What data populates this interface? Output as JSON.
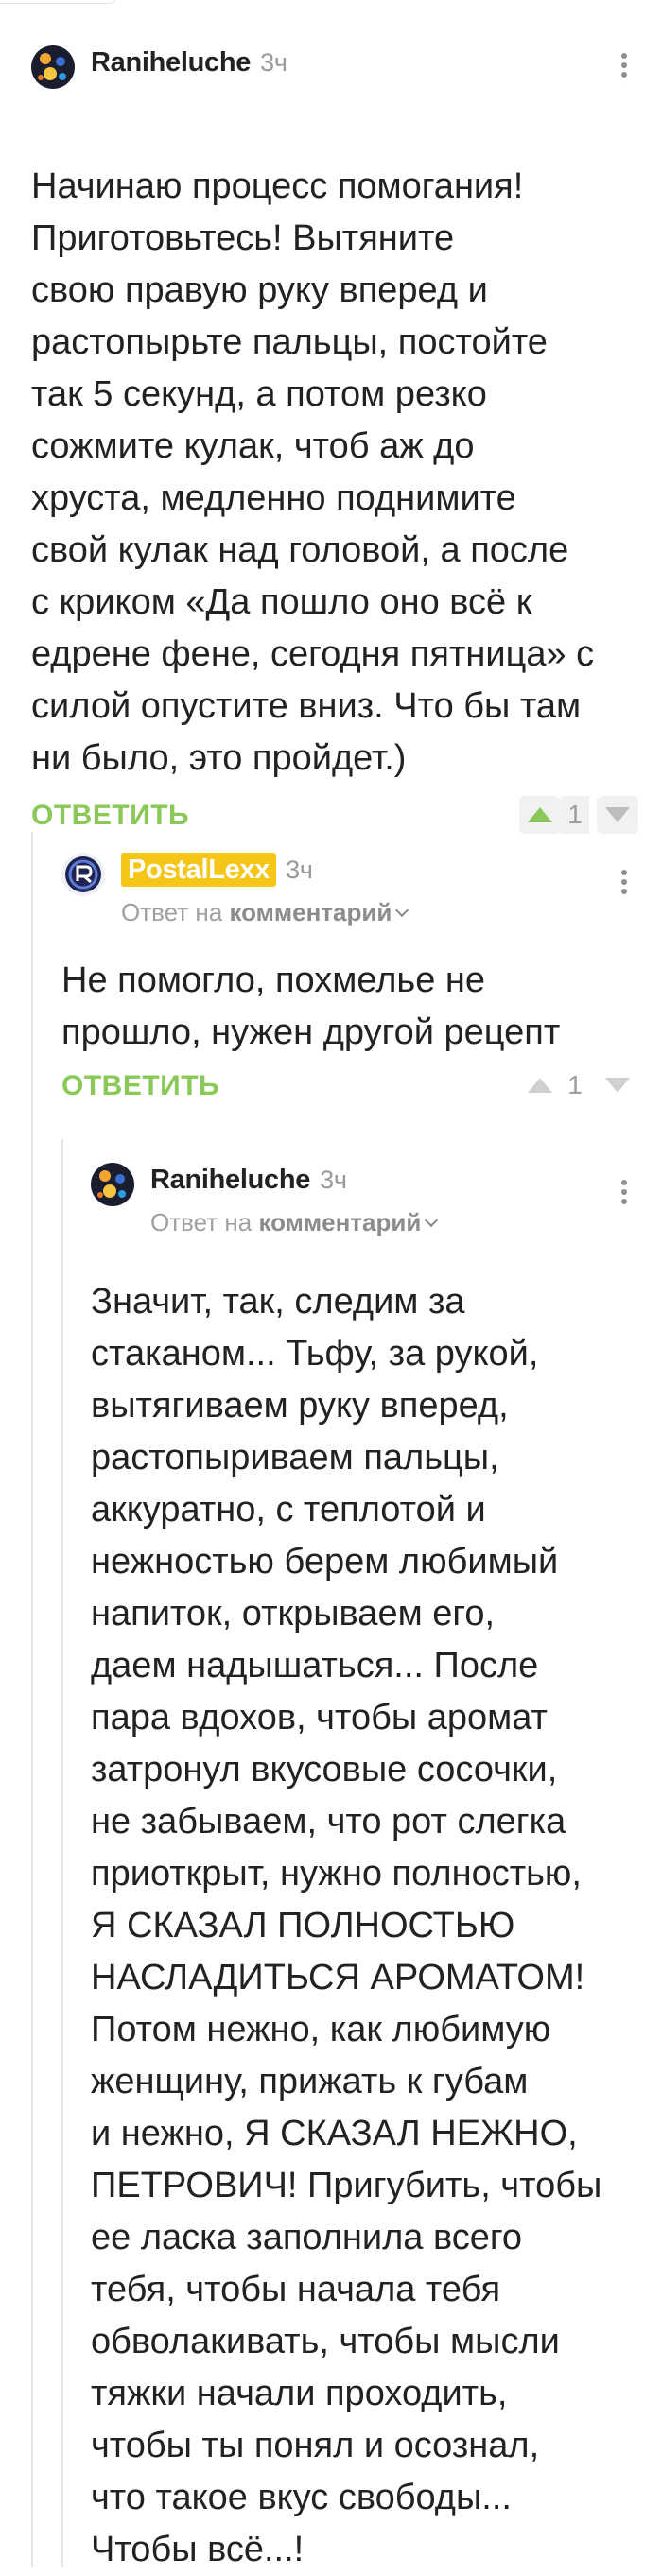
{
  "comments": [
    {
      "author": "Raniheluche",
      "time": "3ч",
      "text": "Начинаю процесс помогания!\nПриготовьтесь! Вытяните\nсвою правую руку вперед и\nрастопырьте пальцы, постойте\nтак 5 секунд, а потом резко\nсожмите кулак, чтоб аж до\nхруста, медленно поднимите\nсвой кулак над головой, а после\nс криком «Да пошло оно всё к\nедрене фене, сегодня пятница» с\nсилой опустите вниз. Что бы там\nни было, это пройдет.)",
      "reply_label": "ОТВЕТИТЬ",
      "votes": "1",
      "voted_up": true
    },
    {
      "author": "PostalLexx",
      "time": "3ч",
      "reply_prefix": "Ответ на",
      "reply_target": "комментарий",
      "text": "Не помогло, похмелье не\nпрошло, нужен другой рецепт",
      "reply_label": "ОТВЕТИТЬ",
      "votes": "1",
      "voted_up": false
    },
    {
      "author": "Raniheluche",
      "time": "3ч",
      "reply_prefix": "Ответ на",
      "reply_target": "комментарий",
      "text": "Значит, так, следим за\nстаканом... Тьфу, за рукой,\nвытягиваем руку вперед,\nрастопыриваем пальцы,\nаккуратно, с теплотой и\nнежностью берем любимый\nнапиток, открываем его,\nдаем надышаться... После\nпара вдохов, чтобы аромат\nзатронул вкусовые сосочки,\nне забываем, что рот слегка\nприоткрыт, нужно полностью,\nЯ СКАЗАЛ ПОЛНОСТЬЮ\nНАСЛАДИТЬСЯ АРОМАТОМ!\nПотом нежно, как любимую\nженщину, прижать к губам\nи нежно, Я СКАЗАЛ НЕЖНО,\nПЕТРОВИЧ! Пригубить, чтобы\nее ласка заполнила всего\nтебя, чтобы начала тебя\nобволакивать, чтобы мысли\nтяжки начали проходить,\nчтобы ты понял и осознал,\nчто такое вкус свободы...\nЧтобы всё...!"
    }
  ],
  "colors": {
    "accent_green": "#8ac858",
    "badge_yellow": "#f5c518",
    "muted": "#9a9a9a"
  }
}
